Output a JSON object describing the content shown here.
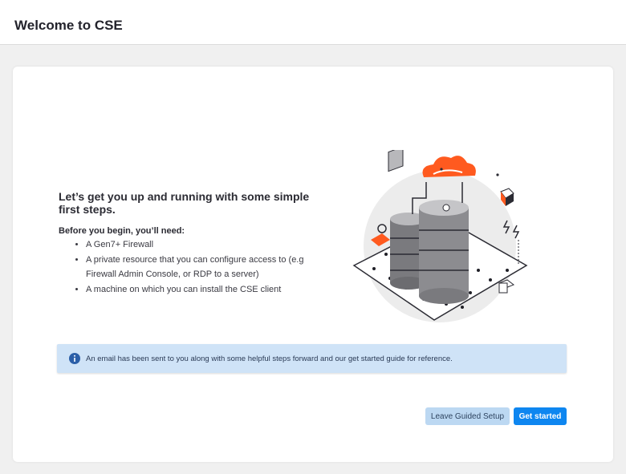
{
  "header": {
    "title": "Welcome to CSE"
  },
  "intro": {
    "headline": "Let’s get you up and running with some simple first steps.",
    "before_title": "Before you begin, you’ll need:",
    "requirements": [
      "A Gen7+ Firewall",
      "A private resource that you can configure access to (e.g Firewall Admin Console, or RDP to a server)",
      "A machine on which you can install the CSE client"
    ]
  },
  "illustration": {
    "name": "cloud-servers-illustration",
    "accent": "#ff5a1f"
  },
  "banner": {
    "icon": "info-icon",
    "text": "An email has been sent to you along with some helpful steps forward and our get started guide for reference."
  },
  "actions": {
    "leave_label": "Leave Guided Setup",
    "start_label": "Get started"
  },
  "colors": {
    "primary": "#0e86f0",
    "secondary": "#bcd8f2",
    "banner_bg": "#cfe3f7",
    "accent": "#ff5a1f"
  }
}
